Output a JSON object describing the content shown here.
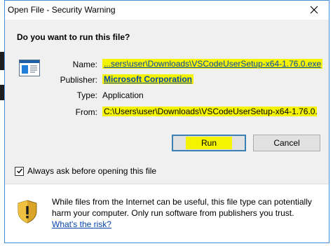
{
  "window": {
    "title": "Open File - Security Warning",
    "close_glyph": "✕"
  },
  "prompt": {
    "question": "Do you want to run this file?"
  },
  "details": {
    "name_label": "Name:",
    "name_value": "...sers\\user\\Downloads\\VSCodeUserSetup-x64-1.76.0.exe",
    "publisher_label": "Publisher:",
    "publisher_value": "Microsoft Corporation",
    "type_label": "Type:",
    "type_value": "Application",
    "from_label": "From:",
    "from_value": "C:\\Users\\user\\Downloads\\VSCodeUserSetup-x64-1.76.0...."
  },
  "buttons": {
    "run_label": "Run",
    "cancel_label": "Cancel"
  },
  "options": {
    "always_ask_label": "Always ask before opening this file",
    "always_ask_checked": true
  },
  "footer": {
    "warning_text": "While files from the Internet can be useful, this file type can potentially harm your computer. Only run software from publishers you trust.",
    "risk_link": "What's the risk?"
  },
  "colors": {
    "highlight": "#f4f400",
    "link": "#0645ad",
    "dialog_body": "#f0f0f0",
    "window_border": "#4a90d9"
  },
  "icons": {
    "file": "application-window-icon",
    "shield": "security-shield-icon",
    "close": "close-icon"
  }
}
